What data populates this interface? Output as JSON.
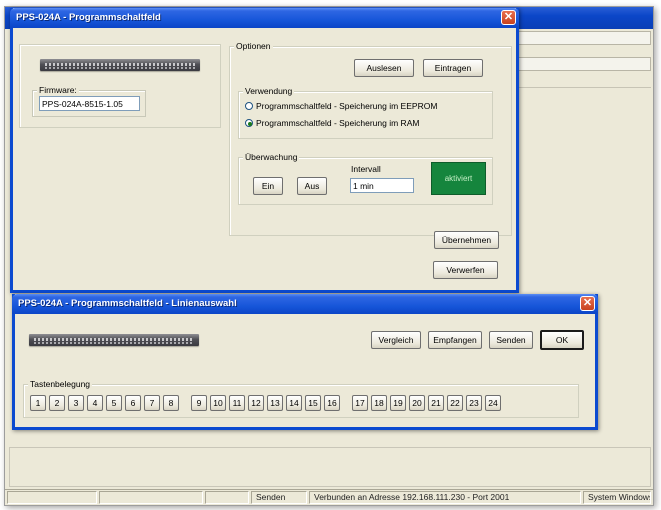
{
  "main_window": {
    "title": "PPS-024A - Programmschaltfeld",
    "firmware": {
      "label": "Firmware:",
      "value": "PPS-024A-8515-1.05"
    },
    "optionen": {
      "label": "Optionen",
      "read_button": "Auslesen",
      "write_button": "Eintragen"
    },
    "verwendung": {
      "label": "Verwendung",
      "options": [
        {
          "label": "Programmschaltfeld - Speicherung im EEPROM",
          "selected": false
        },
        {
          "label": "Programmschaltfeld - Speicherung im RAM",
          "selected": true
        }
      ]
    },
    "ueberwachung": {
      "label": "Überwachung",
      "on_button": "Ein",
      "off_button": "Aus",
      "interval_label": "Intervall",
      "interval_value": "1 min",
      "status_text": "aktiviert",
      "status_color": "#15853d"
    },
    "apply_button": "Übernehmen",
    "discard_button": "Verwerfen"
  },
  "line_window": {
    "title": "PPS-024A - Programmschaltfeld - Linienauswahl",
    "compare_button": "Vergleich",
    "receive_button": "Empfangen",
    "send_button": "Senden",
    "ok_button": "OK",
    "tastenbelegung": {
      "label": "Tastenbelegung",
      "keys": [
        "1",
        "2",
        "3",
        "4",
        "5",
        "6",
        "7",
        "8",
        "9",
        "10",
        "11",
        "12",
        "13",
        "14",
        "15",
        "16",
        "17",
        "18",
        "19",
        "20",
        "21",
        "22",
        "23",
        "24"
      ]
    }
  },
  "statusbar": {
    "cells": [
      "",
      "",
      "",
      "Senden",
      "Verbunden an Adresse 192.168.111.230 - Port 2001",
      "System Windows XP"
    ]
  },
  "colors": {
    "titlebar": "#0b45c7",
    "close_button": "#c8421f",
    "window_bg": "#ece9d8"
  }
}
